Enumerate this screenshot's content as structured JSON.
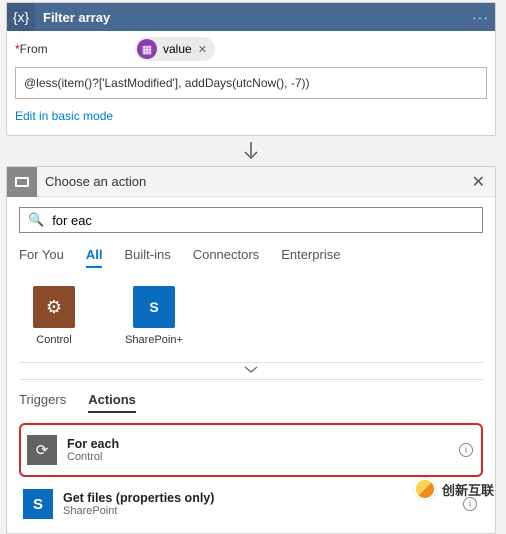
{
  "filter": {
    "title": "Filter array",
    "from_label": "From",
    "value_chip": "value",
    "expression": "@less(item()?['LastModified'], addDays(utcNow(), -7))",
    "edit_link": "Edit in basic mode"
  },
  "choose": {
    "title": "Choose an action",
    "search_value": "for eac",
    "category_tabs": [
      "For You",
      "All",
      "Built-ins",
      "Connectors",
      "Enterprise"
    ],
    "category_active": 1,
    "connectors": [
      {
        "label": "Control",
        "kind": "control"
      },
      {
        "label": "SharePoin+",
        "kind": "sp"
      }
    ],
    "sub_tabs": [
      "Triggers",
      "Actions"
    ],
    "sub_active": 1,
    "actions": [
      {
        "title": "For each",
        "subtitle": "Control",
        "icon": "ctl",
        "highlight": true
      },
      {
        "title": "Get files (properties only)",
        "subtitle": "SharePoint",
        "icon": "sp",
        "highlight": false
      }
    ]
  },
  "brand": "创新互联"
}
